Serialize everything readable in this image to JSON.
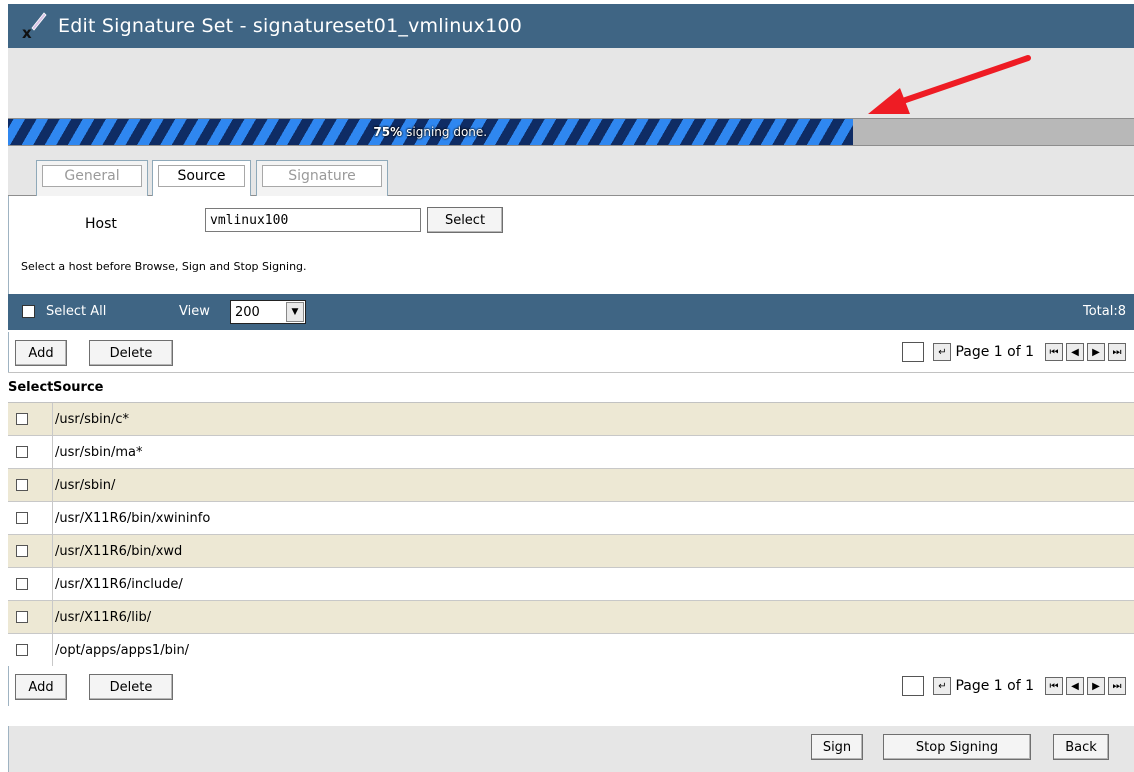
{
  "window": {
    "title": "Edit Signature Set - signatureset01_vmlinux100"
  },
  "progress": {
    "percent_label": "75%",
    "text": "signing done.",
    "fraction": 0.75
  },
  "tabs": [
    {
      "label": "General",
      "active": false
    },
    {
      "label": "Source",
      "active": true
    },
    {
      "label": "Signature",
      "active": false
    }
  ],
  "host": {
    "label": "Host",
    "value": "vmlinux100",
    "select_label": "Select",
    "hint": "Select a host before Browse, Sign and Stop Signing."
  },
  "viewbar": {
    "select_all": "Select All",
    "view_label": "View",
    "view_value": "200",
    "total": "Total:8"
  },
  "toolbar": {
    "add_label": "Add",
    "delete_label": "Delete",
    "page_text": "Page 1 of 1"
  },
  "table": {
    "headers": [
      "Select",
      "Source"
    ],
    "rows": [
      "/usr/sbin/c*",
      "/usr/sbin/ma*",
      "/usr/sbin/",
      "/usr/X11R6/bin/xwininfo",
      "/usr/X11R6/bin/xwd",
      "/usr/X11R6/include/",
      "/usr/X11R6/lib/",
      "/opt/apps/apps1/bin/"
    ]
  },
  "actions": {
    "sign_label": "Sign",
    "stop_label": "Stop Signing",
    "back_label": "Back"
  }
}
